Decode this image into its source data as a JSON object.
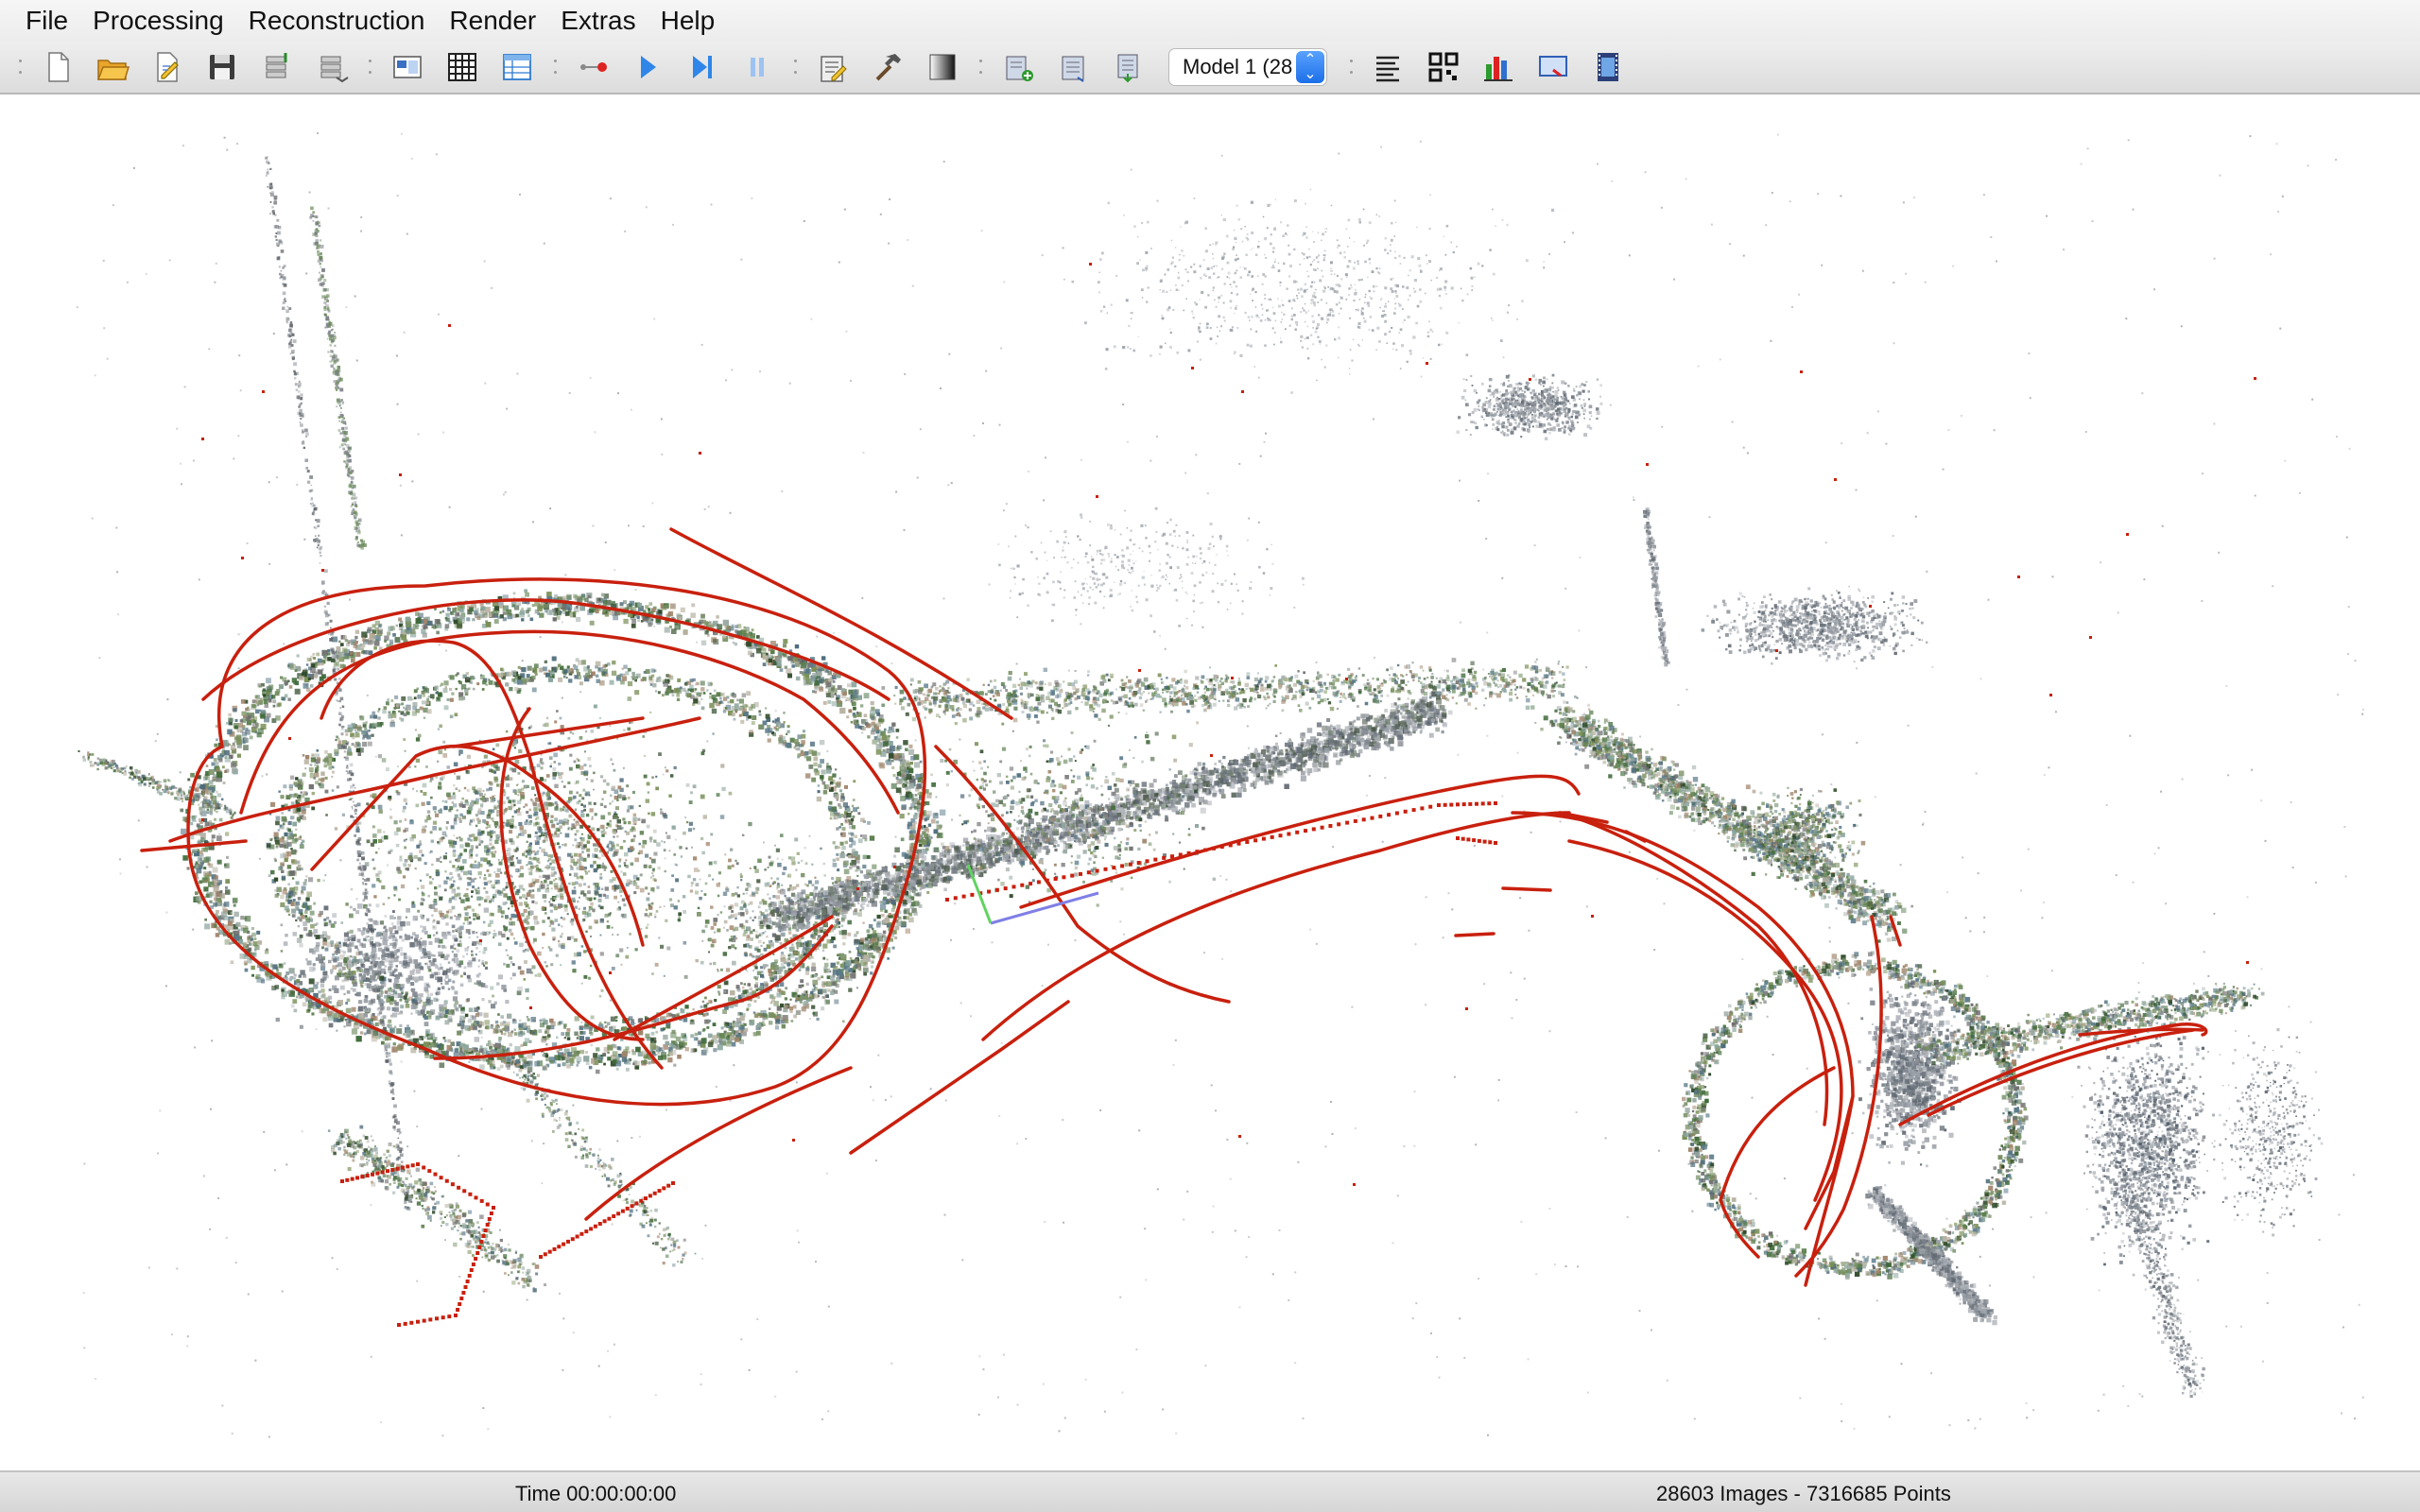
{
  "menu": {
    "items": [
      "File",
      "Processing",
      "Reconstruction",
      "Render",
      "Extras",
      "Help"
    ]
  },
  "toolbar": {
    "icons": [
      "new-project-icon",
      "open-project-icon",
      "edit-project-icon",
      "save-project-icon",
      "import-model-icon",
      "export-model-icon",
      "feature-extraction-icon",
      "feature-matching-icon",
      "database-management-icon",
      "automatic-reconstruction-icon",
      "start-reconstruction-icon",
      "step-reconstruction-icon",
      "pause-reconstruction-icon",
      "reconstruction-options-icon",
      "bundle-adjustment-icon",
      "dense-reconstruction-icon",
      "render-options-icon",
      "reset-view-icon",
      "grab-image-icon"
    ],
    "model_select": {
      "value": "Model 1 (28"
    },
    "right_icons": [
      "show-log-icon",
      "match-matrix-icon",
      "model-statistics-icon",
      "grab-image-icon",
      "grab-movie-icon"
    ]
  },
  "colors": {
    "trajectory": "#c8200e",
    "axis_x": "#7f7fe6",
    "axis_y": "#5fd35f",
    "select_accent": "#1c6fe8"
  },
  "status": {
    "time": "Time 00:00:00:00",
    "count": "28603 Images - 7316685 Points"
  }
}
